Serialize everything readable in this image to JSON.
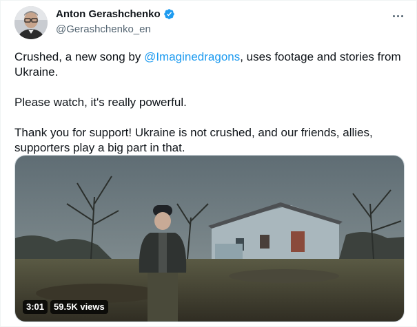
{
  "author": {
    "display_name": "Anton Gerashchenko",
    "handle": "@Gerashchenko_en",
    "verified": true,
    "verified_color": "#1d9bf0"
  },
  "menu": {
    "icon": "more-horizontal-icon"
  },
  "tweet": {
    "p1_before": "Crushed, a new song by ",
    "p1_mention": "@Imaginedragons",
    "p1_after": ", uses footage and stories from Ukraine.",
    "p2": "Please watch, it's really powerful.",
    "p3": "Thank you for support! Ukraine is not crushed, and our friends, allies, supporters play a big part in that."
  },
  "video": {
    "duration": "3:01",
    "views": "59.5K views"
  },
  "colors": {
    "text": "#0f1419",
    "secondary": "#536471",
    "link": "#1d9bf0"
  }
}
